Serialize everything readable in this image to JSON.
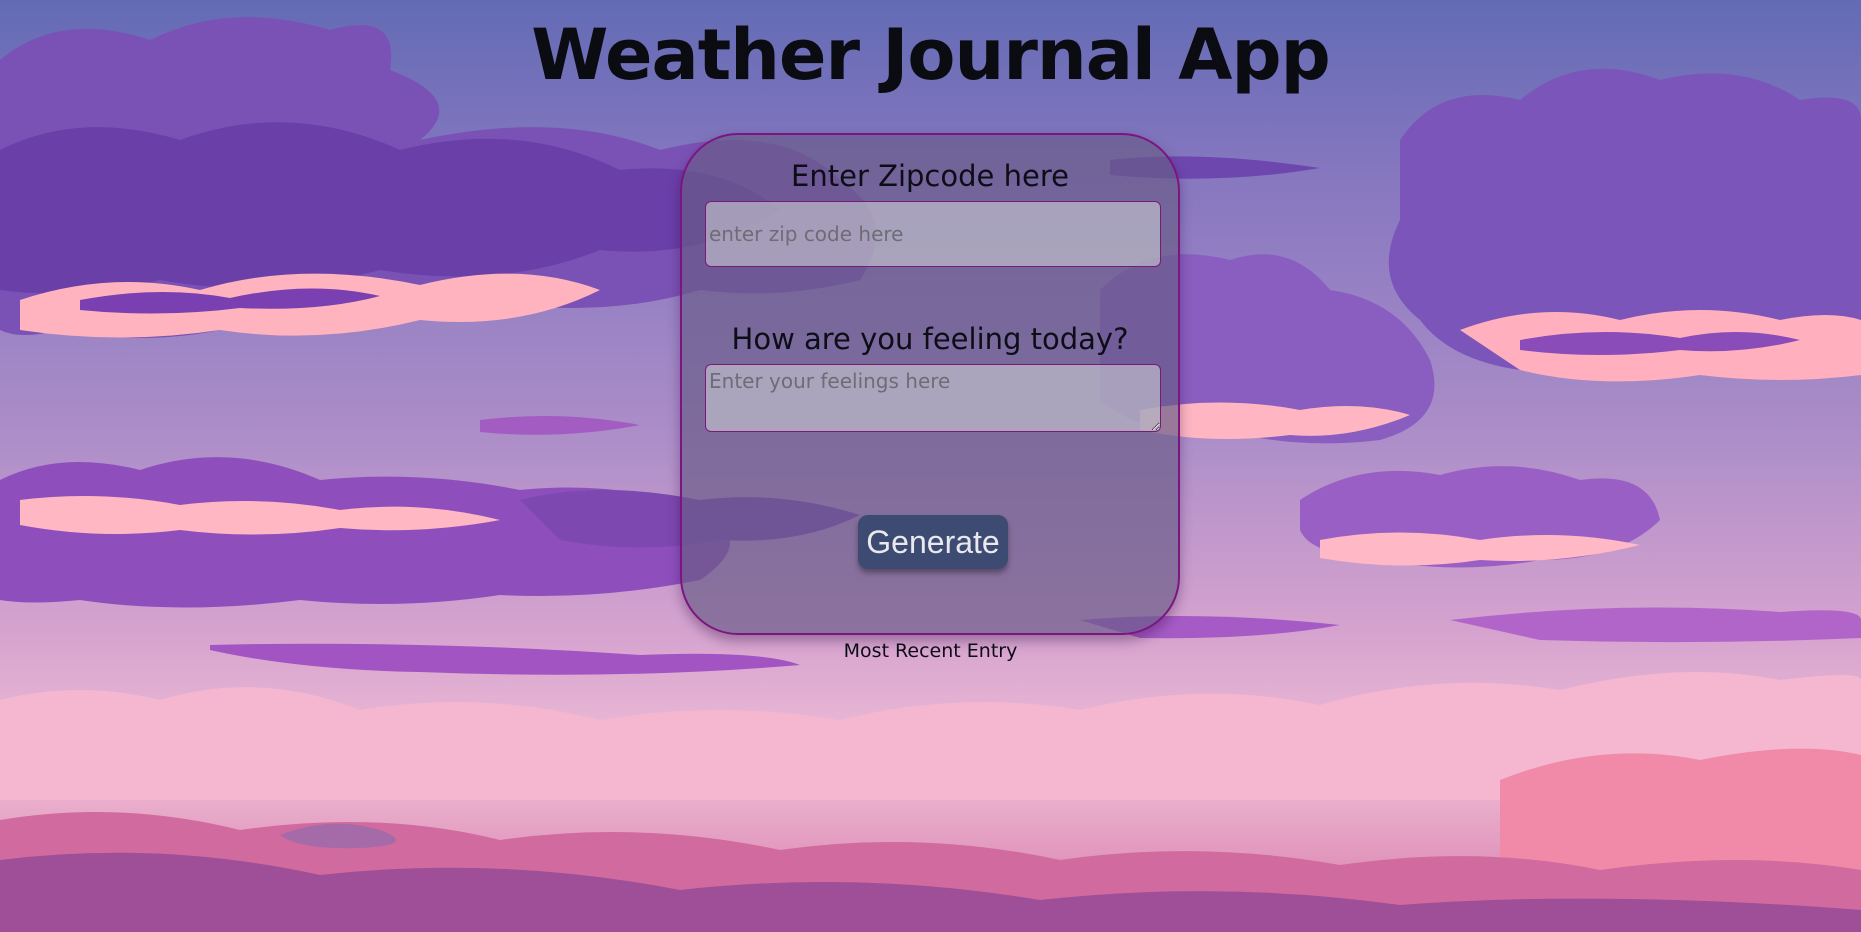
{
  "app": {
    "title": "Weather Journal App"
  },
  "form": {
    "zip_label": "Enter Zipcode here",
    "zip_placeholder": "enter zip code here",
    "zip_value": "",
    "feelings_label": "How are you feeling today?",
    "feelings_placeholder": "Enter your feelings here",
    "feelings_value": "",
    "generate_label": "Generate"
  },
  "entry": {
    "heading": "Most Recent Entry"
  },
  "colors": {
    "card_border": "#7d1580",
    "button_bg": "#3d4b73",
    "button_text": "#e8e8ee",
    "cloud_dark": "#7a4fb8",
    "cloud_pink": "#ffb1bd"
  }
}
